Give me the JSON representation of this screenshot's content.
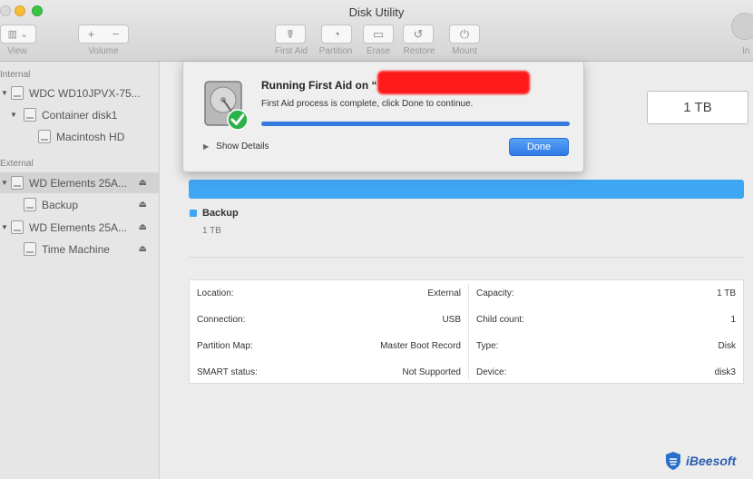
{
  "window": {
    "title": "Disk Utility"
  },
  "toolbar": {
    "view_label": "View",
    "volume_label": "Volume",
    "volume_add": "+",
    "volume_remove": "−",
    "first_aid_label": "First Aid",
    "partition_label": "Partition",
    "erase_label": "Erase",
    "restore_label": "Restore",
    "mount_label": "Mount",
    "info_label_clipped": "In"
  },
  "sidebar": {
    "internal_header": "Internal",
    "external_header": "External",
    "items": [
      {
        "label": "WDC WD10JPVX-75...",
        "level": 0,
        "disclosure": "▼",
        "eject": ""
      },
      {
        "label": "Container disk1",
        "level": 1,
        "disclosure": "▼",
        "eject": ""
      },
      {
        "label": "Macintosh HD",
        "level": 2,
        "disclosure": "",
        "eject": ""
      },
      {
        "label": "WD Elements 25A...",
        "level": 0,
        "disclosure": "▼",
        "eject": "⏏",
        "selected": true
      },
      {
        "label": "Backup",
        "level": 1,
        "disclosure": "",
        "eject": "⏏"
      },
      {
        "label": "WD Elements 25A...",
        "level": 0,
        "disclosure": "▼",
        "eject": "⏏"
      },
      {
        "label": "Time Machine",
        "level": 1,
        "disclosure": "",
        "eject": "⏏"
      }
    ]
  },
  "dialog": {
    "title": "Running First Aid on “",
    "message": "First Aid process is complete, click Done to continue.",
    "progress": 1.0,
    "show_details": "Show Details",
    "done_button": "Done"
  },
  "main": {
    "capacity": "1 TB",
    "legend_name": "Backup",
    "legend_size": "1 TB",
    "info_left": [
      {
        "label": "Location:",
        "value": "External"
      },
      {
        "label": "Connection:",
        "value": "USB"
      },
      {
        "label": "Partition Map:",
        "value": "Master Boot Record"
      },
      {
        "label": "SMART status:",
        "value": "Not Supported"
      }
    ],
    "info_right": [
      {
        "label": "Capacity:",
        "value": "1 TB"
      },
      {
        "label": "Child count:",
        "value": "1"
      },
      {
        "label": "Type:",
        "value": "Disk"
      },
      {
        "label": "Device:",
        "value": "disk3"
      }
    ]
  },
  "watermark": {
    "text": "iBeesoft"
  },
  "colors": {
    "accent": "#3478e0",
    "usage_bar": "#3ea7f3",
    "success": "#2db24a"
  }
}
